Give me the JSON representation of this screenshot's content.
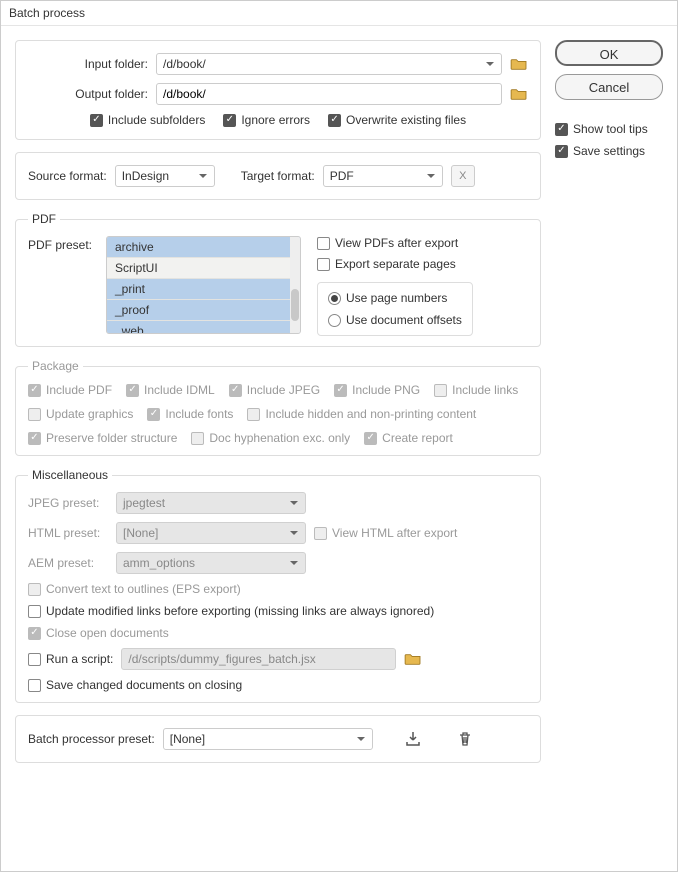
{
  "title": "Batch process",
  "buttons": {
    "ok": "OK",
    "cancel": "Cancel"
  },
  "side_checks": {
    "show_tooltips": "Show tool tips",
    "save_settings": "Save settings"
  },
  "folders": {
    "input_label": "Input folder:",
    "output_label": "Output folder:",
    "input_value": "/d/book/",
    "output_value": "/d/book/",
    "include_subfolders": "Include subfolders",
    "ignore_errors": "Ignore errors",
    "overwrite": "Overwrite existing files"
  },
  "formats": {
    "source_label": "Source format:",
    "source_value": "InDesign",
    "target_label": "Target format:",
    "target_value": "PDF",
    "x_btn": "X"
  },
  "pdf": {
    "legend": "PDF",
    "preset_label": "PDF preset:",
    "list": [
      "archive",
      "ScriptUI",
      "_print",
      "_proof",
      "_web"
    ],
    "view_after": "View PDFs after export",
    "export_separate": "Export separate pages",
    "use_page_numbers": "Use page numbers",
    "use_doc_offsets": "Use document offsets"
  },
  "package": {
    "legend": "Package",
    "include_pdf": "Include PDF",
    "include_idml": "Include IDML",
    "include_jpeg": "Include JPEG",
    "include_png": "Include PNG",
    "include_links": "Include links",
    "update_graphics": "Update graphics",
    "include_fonts": "Include fonts",
    "include_hidden": "Include hidden and non-printing content",
    "preserve_folder": "Preserve folder structure",
    "doc_hyph": "Doc hyphenation exc. only",
    "create_report": "Create report"
  },
  "misc": {
    "legend": "Miscellaneous",
    "jpeg_label": "JPEG preset:",
    "jpeg_value": "jpegtest",
    "html_label": "HTML preset:",
    "html_value": "[None]",
    "view_html": "View HTML after export",
    "aem_label": "AEM preset:",
    "aem_value": "amm_options",
    "convert_text": "Convert text to outlines (EPS export)",
    "update_links": "Update modified links before exporting (missing links are always ignored)",
    "close_docs": "Close open documents",
    "run_script": "Run a script:",
    "script_path": "/d/scripts/dummy_figures_batch.jsx",
    "save_changed": "Save changed documents on closing"
  },
  "batch_preset": {
    "label": "Batch processor preset:",
    "value": "[None]"
  }
}
